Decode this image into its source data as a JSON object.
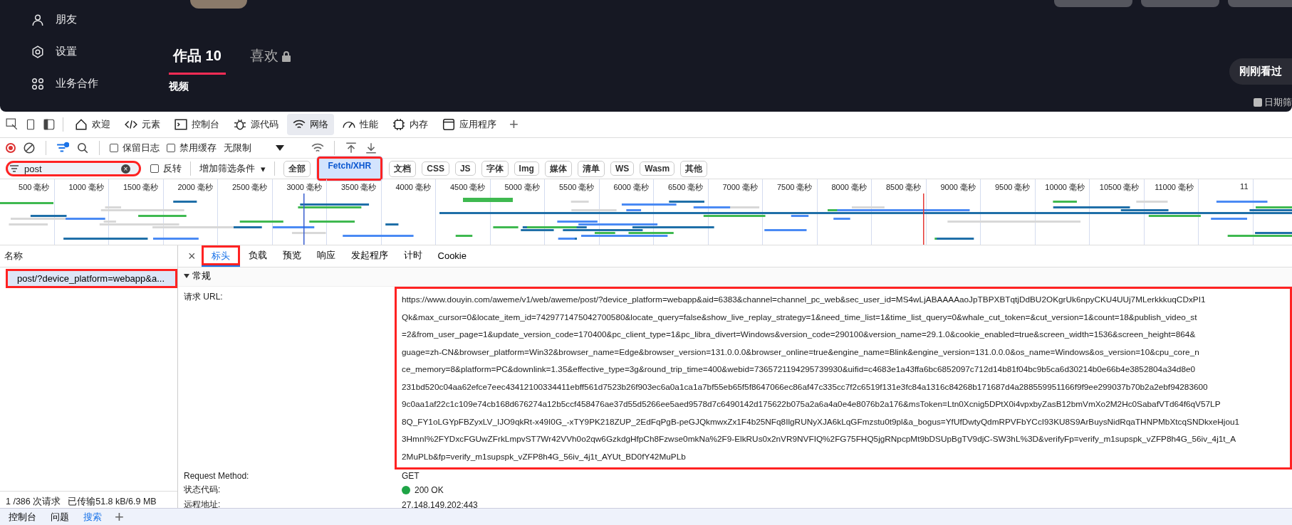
{
  "site": {
    "sidebar": [
      {
        "label": "朋友"
      },
      {
        "label": "设置"
      },
      {
        "label": "业务合作"
      }
    ],
    "tabs": [
      {
        "label": "作品",
        "count": "10",
        "selected": true,
        "locked": false
      },
      {
        "label": "喜欢",
        "selected": false,
        "locked": true
      }
    ],
    "section": "视频",
    "recent_button": "刚刚看过",
    "date_filter": "日期筛"
  },
  "devtools": {
    "tabs": [
      {
        "label": "欢迎",
        "selected": false
      },
      {
        "label": "元素",
        "selected": false
      },
      {
        "label": "控制台",
        "selected": false
      },
      {
        "label": "源代码",
        "selected": false
      },
      {
        "label": "网络",
        "selected": true
      },
      {
        "label": "性能",
        "selected": false
      },
      {
        "label": "内存",
        "selected": false
      },
      {
        "label": "应用程序",
        "selected": false
      }
    ],
    "add_tab": "+",
    "toolbar": {
      "preserve_log": {
        "label": "保留日志",
        "checked": false
      },
      "disable_cache": {
        "label": "禁用缓存",
        "checked": false
      },
      "throttle": "无限制"
    },
    "filter": {
      "value": "post",
      "clear": "×",
      "highlighted": true,
      "invert": {
        "label": "反转",
        "checked": false
      },
      "more_filters": "增加筛选条件",
      "more_caret": "▾"
    },
    "types": [
      {
        "label": "全部",
        "selected": false,
        "highlighted": false
      },
      {
        "label": "Fetch/XHR",
        "selected": true,
        "highlighted": true
      },
      {
        "label": "文档",
        "selected": false,
        "highlighted": false
      },
      {
        "label": "CSS",
        "selected": false,
        "highlighted": false
      },
      {
        "label": "JS",
        "selected": false,
        "highlighted": false
      },
      {
        "label": "字体",
        "selected": false,
        "highlighted": false
      },
      {
        "label": "Img",
        "selected": false,
        "highlighted": false
      },
      {
        "label": "媒体",
        "selected": false,
        "highlighted": false
      },
      {
        "label": "清单",
        "selected": false,
        "highlighted": false
      },
      {
        "label": "WS",
        "selected": false,
        "highlighted": false
      },
      {
        "label": "Wasm",
        "selected": false,
        "highlighted": false
      },
      {
        "label": "其他",
        "selected": false,
        "highlighted": false
      }
    ],
    "timeline_ticks": [
      "500 毫秒",
      "1000 毫秒",
      "1500 毫秒",
      "2000 毫秒",
      "2500 毫秒",
      "3000 毫秒",
      "3500 毫秒",
      "4000 毫秒",
      "4500 毫秒",
      "5000 毫秒",
      "5500 毫秒",
      "6000 毫秒",
      "6500 毫秒",
      "7000 毫秒",
      "7500 毫秒",
      "8000 毫秒",
      "8500 毫秒",
      "9000 毫秒",
      "9500 毫秒",
      "10000 毫秒",
      "10500 毫秒",
      "11000 毫秒",
      "11"
    ],
    "requests": {
      "header": "名称",
      "rows": [
        {
          "name": "post/?device_platform=webapp&a...",
          "selected": true,
          "highlighted": true
        }
      ],
      "count": "1 /386 次请求",
      "transferred": "已传输51.8 kB/6.9 MB"
    },
    "detail": {
      "close": "×",
      "tabs": [
        {
          "label": "标头",
          "selected": true,
          "highlighted": true
        },
        {
          "label": "负载",
          "selected": false,
          "highlighted": false
        },
        {
          "label": "预览",
          "selected": false,
          "highlighted": false
        },
        {
          "label": "响应",
          "selected": false,
          "highlighted": false
        },
        {
          "label": "发起程序",
          "selected": false,
          "highlighted": false
        },
        {
          "label": "计时",
          "selected": false,
          "highlighted": false
        },
        {
          "label": "Cookie",
          "selected": false,
          "highlighted": false
        }
      ],
      "section": {
        "title": "常规",
        "expanded": true
      },
      "url": {
        "label": "请求 URL:",
        "highlighted": true,
        "lines": [
          "https://www.douyin.com/aweme/v1/web/aweme/post/?device_platform=webapp&aid=6383&channel=channel_pc_web&sec_user_id=MS4wLjABAAAAaoJpTBPXBTqtjDdBU2OKgrUk6npyCKU4UUj7MLerkkkuqCDxPI1",
          "Qk&max_cursor=0&locate_item_id=7429771475042700580&locate_query=false&show_live_replay_strategy=1&need_time_list=1&time_list_query=0&whale_cut_token=&cut_version=1&count=18&publish_video_st",
          "=2&from_user_page=1&update_version_code=170400&pc_client_type=1&pc_libra_divert=Windows&version_code=290100&version_name=29.1.0&cookie_enabled=true&screen_width=1536&screen_height=864&",
          "guage=zh-CN&browser_platform=Win32&browser_name=Edge&browser_version=131.0.0.0&browser_online=true&engine_name=Blink&engine_version=131.0.0.0&os_name=Windows&os_version=10&cpu_core_n",
          "ce_memory=8&platform=PC&downlink=1.35&effective_type=3g&round_trip_time=400&webid=7365721194295739930&uifid=c4683e1a43ffa6bc6852097c712d14b81f04bc9b5ca6d30214b0e66b4e3852804a34d8e0",
          "231bd520c04aa62efce7eec43412100334411ebff561d7523b26f903ec6a0a1ca1a7bf55eb65f5f8647066ec86af47c335cc7f2c6519f131e3fc84a1316c84268b171687d4a288559951166f9f9ee299037b70b2a2ebf94283600",
          "9c0aa1af22c1c109e74cb168d676274a12b5ccf458476ae37d55d5266ee5aed9578d7c6490142d175622b075a2a6a4a0e4e8076b2a176&msToken=Ltn0Xcnig5DPtX0i4vpxbyZasB12bmVmXo2M2Hc0SabafVTd64f6qV57LP",
          "8Q_FY1oLGYpFBZyxLV_IJO9qkRt-x49I0G_-xTY9PK218ZUP_2EdFqPgB-peGJQkmwxZx1F4b25NFq8IlgRUNyXJA6kLqGFmzstu0t9pl&a_bogus=YfUfDwtyQdmRPVFbYCcI93KU8S9ArBuysNidRqaTHNPMbXtcqSNDkxeHjou1",
          "3HmnI%2FYDxcFGUwZFrkLmpvST7Wr42VVh0o2qw6GzkdgHfpCh8Fzwse0mkNa%2F9-ElkRUs0x2nVR9NVFIQ%2FG75FHQ5jgRNpcpMt9bDSUpBgTV9djC-SW3hL%3D&verifyFp=verify_m1supspk_vZFP8h4G_56iv_4j1t_A",
          "2MuPLb&fp=verify_m1supspk_vZFP8h4G_56iv_4j1t_AYUt_BD0fY42MuPLb"
        ]
      },
      "fields": [
        {
          "label": "Request Method:",
          "value": "GET",
          "kind": "text"
        },
        {
          "label": "状态代码:",
          "value": "200 OK",
          "kind": "status",
          "color": "#1ea446"
        },
        {
          "label": "远程地址:",
          "value": "27.148.149.202:443",
          "kind": "text"
        }
      ]
    }
  },
  "drawer": {
    "tabs": [
      {
        "label": "控制台",
        "selected": false
      },
      {
        "label": "问题",
        "selected": false
      },
      {
        "label": "搜索",
        "selected": true
      }
    ],
    "add_tab": "+"
  }
}
